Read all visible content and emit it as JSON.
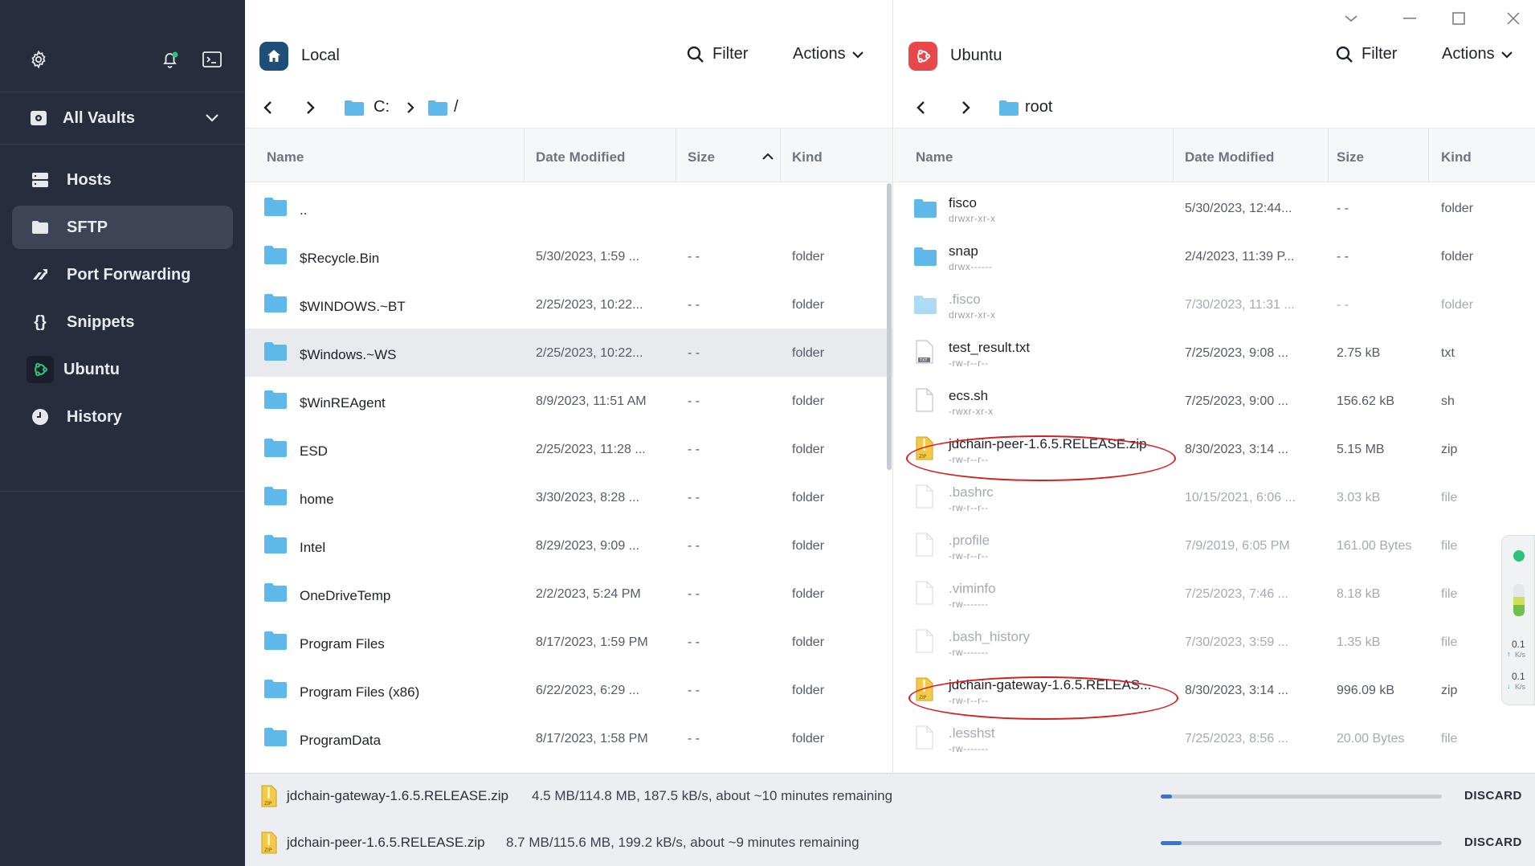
{
  "sidebar": {
    "vaults_label": "All Vaults",
    "items": [
      {
        "label": "Hosts",
        "icon": "hosts-icon"
      },
      {
        "label": "SFTP",
        "icon": "folder-icon"
      },
      {
        "label": "Port Forwarding",
        "icon": "port-forwarding-icon"
      },
      {
        "label": "Snippets",
        "icon": "braces-icon"
      },
      {
        "label": "Ubuntu",
        "icon": "ubuntu-icon"
      },
      {
        "label": "History",
        "icon": "clock-icon"
      }
    ]
  },
  "left": {
    "host": "Local",
    "filter": "Filter",
    "actions": "Actions",
    "path": [
      "C:",
      "/"
    ],
    "columns": [
      "Name",
      "Date Modified",
      "Size",
      "Kind"
    ],
    "rows": [
      {
        "name": "..",
        "date": "",
        "size": "",
        "kind": ""
      },
      {
        "name": "$Recycle.Bin",
        "date": "5/30/2023, 1:59 ...",
        "size": "- -",
        "kind": "folder"
      },
      {
        "name": "$WINDOWS.~BT",
        "date": "2/25/2023, 10:22...",
        "size": "- -",
        "kind": "folder"
      },
      {
        "name": "$Windows.~WS",
        "date": "2/25/2023, 10:22...",
        "size": "- -",
        "kind": "folder"
      },
      {
        "name": "$WinREAgent",
        "date": "8/9/2023, 11:51 AM",
        "size": "- -",
        "kind": "folder"
      },
      {
        "name": "ESD",
        "date": "2/25/2023, 11:28 ...",
        "size": "- -",
        "kind": "folder"
      },
      {
        "name": "home",
        "date": "3/30/2023, 8:28 ...",
        "size": "- -",
        "kind": "folder"
      },
      {
        "name": "Intel",
        "date": "8/29/2023, 9:09 ...",
        "size": "- -",
        "kind": "folder"
      },
      {
        "name": "OneDriveTemp",
        "date": "2/2/2023, 5:24 PM",
        "size": "- -",
        "kind": "folder"
      },
      {
        "name": "Program Files",
        "date": "8/17/2023, 1:59 PM",
        "size": "- -",
        "kind": "folder"
      },
      {
        "name": "Program Files (x86)",
        "date": "6/22/2023, 6:29 ...",
        "size": "- -",
        "kind": "folder"
      },
      {
        "name": "ProgramData",
        "date": "8/17/2023, 1:58 PM",
        "size": "- -",
        "kind": "folder"
      }
    ]
  },
  "right": {
    "host": "Ubuntu",
    "filter": "Filter",
    "actions": "Actions",
    "path": [
      "root"
    ],
    "columns": [
      "Name",
      "Date Modified",
      "Size",
      "Kind"
    ],
    "rows": [
      {
        "name": "fisco",
        "perm": "drwxr-xr-x",
        "date": "5/30/2023, 12:44...",
        "size": "- -",
        "kind": "folder",
        "type": "folder"
      },
      {
        "name": "snap",
        "perm": "drwx------",
        "date": "2/4/2023, 11:39 P...",
        "size": "- -",
        "kind": "folder",
        "type": "folder"
      },
      {
        "name": ".fisco",
        "perm": "drwxr-xr-x",
        "date": "7/30/2023, 11:31 ...",
        "size": "- -",
        "kind": "folder",
        "type": "folder-dim"
      },
      {
        "name": "test_result.txt",
        "perm": "-rw-r--r--",
        "date": "7/25/2023, 9:08 ...",
        "size": "2.75 kB",
        "kind": "txt",
        "type": "txt"
      },
      {
        "name": "ecs.sh",
        "perm": "-rwxr-xr-x",
        "date": "7/25/2023, 9:00 ...",
        "size": "156.62 kB",
        "kind": "sh",
        "type": "file"
      },
      {
        "name": "jdchain-peer-1.6.5.RELEASE.zip",
        "perm": "-rw-r--r--",
        "date": "8/30/2023, 3:14 ...",
        "size": "5.15 MB",
        "kind": "zip",
        "type": "zip"
      },
      {
        "name": ".bashrc",
        "perm": "-rw-r--r--",
        "date": "10/15/2021, 6:06 ...",
        "size": "3.03 kB",
        "kind": "file",
        "type": "file-dim"
      },
      {
        "name": ".profile",
        "perm": "-rw-r--r--",
        "date": "7/9/2019, 6:05 PM",
        "size": "161.00 Bytes",
        "kind": "file",
        "type": "file-dim"
      },
      {
        "name": ".viminfo",
        "perm": "-rw-------",
        "date": "7/25/2023, 7:46 ...",
        "size": "8.18 kB",
        "kind": "file",
        "type": "file-dim"
      },
      {
        "name": ".bash_history",
        "perm": "-rw-------",
        "date": "7/30/2023, 3:59 ...",
        "size": "1.35 kB",
        "kind": "file",
        "type": "file-dim"
      },
      {
        "name": "jdchain-gateway-1.6.5.RELEAS...",
        "perm": "-rw-r--r--",
        "date": "8/30/2023, 3:14 ...",
        "size": "996.09 kB",
        "kind": "zip",
        "type": "zip"
      },
      {
        "name": ".lesshst",
        "perm": "-rw-------",
        "date": "7/25/2023, 8:56 ...",
        "size": "20.00 Bytes",
        "kind": "file",
        "type": "file-dim"
      }
    ]
  },
  "transfers": [
    {
      "name": "jdchain-gateway-1.6.5.RELEASE.zip",
      "info": "4.5 MB/114.8 MB, 187.5 kB/s, about ~10 minutes remaining",
      "progress": 0.04,
      "discard": "DISCARD"
    },
    {
      "name": "jdchain-peer-1.6.5.RELEASE.zip",
      "info": "8.7 MB/115.6 MB, 199.2 kB/s, about ~9 minutes remaining",
      "progress": 0.075,
      "discard": "DISCARD"
    }
  ],
  "widget": {
    "up": "0.1",
    "up_unit": "K/s",
    "down": "0.1",
    "down_unit": "K/s"
  },
  "colors": {
    "sidebar": "#282d3e",
    "local_badge": "#1f4e79",
    "ubuntu_badge": "#e8484a",
    "folder": "#5eb8ea",
    "progress": "#2f78d8",
    "annotation": "#d42020"
  }
}
